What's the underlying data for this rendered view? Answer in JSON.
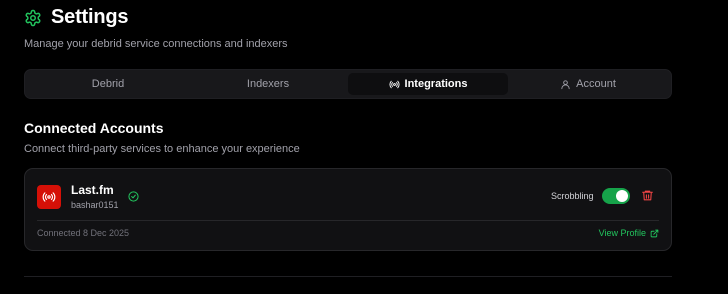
{
  "header": {
    "title": "Settings",
    "subtitle": "Manage your debrid service connections and indexers",
    "icon": "gear-icon"
  },
  "tabs": [
    {
      "label": "Debrid",
      "active": false
    },
    {
      "label": "Indexers",
      "active": false
    },
    {
      "label": "Integrations",
      "active": true,
      "icon": "radio-signal-icon"
    },
    {
      "label": "Account",
      "active": false,
      "icon": "user-icon"
    }
  ],
  "section": {
    "title": "Connected Accounts",
    "description": "Connect third-party services to enhance your experience"
  },
  "account": {
    "service": "Last.fm",
    "username": "bashar0151",
    "verified": true,
    "scrobbling_label": "Scrobbling",
    "scrobbling_enabled": true,
    "connected_text": "Connected 8 Dec 2025",
    "view_profile_label": "View Profile"
  },
  "colors": {
    "accent": "#22c55e",
    "toggle_on": "#16a34a",
    "brand_lastfm": "#d51007",
    "danger": "#ef4444",
    "background": "#000000",
    "card": "#111113"
  }
}
